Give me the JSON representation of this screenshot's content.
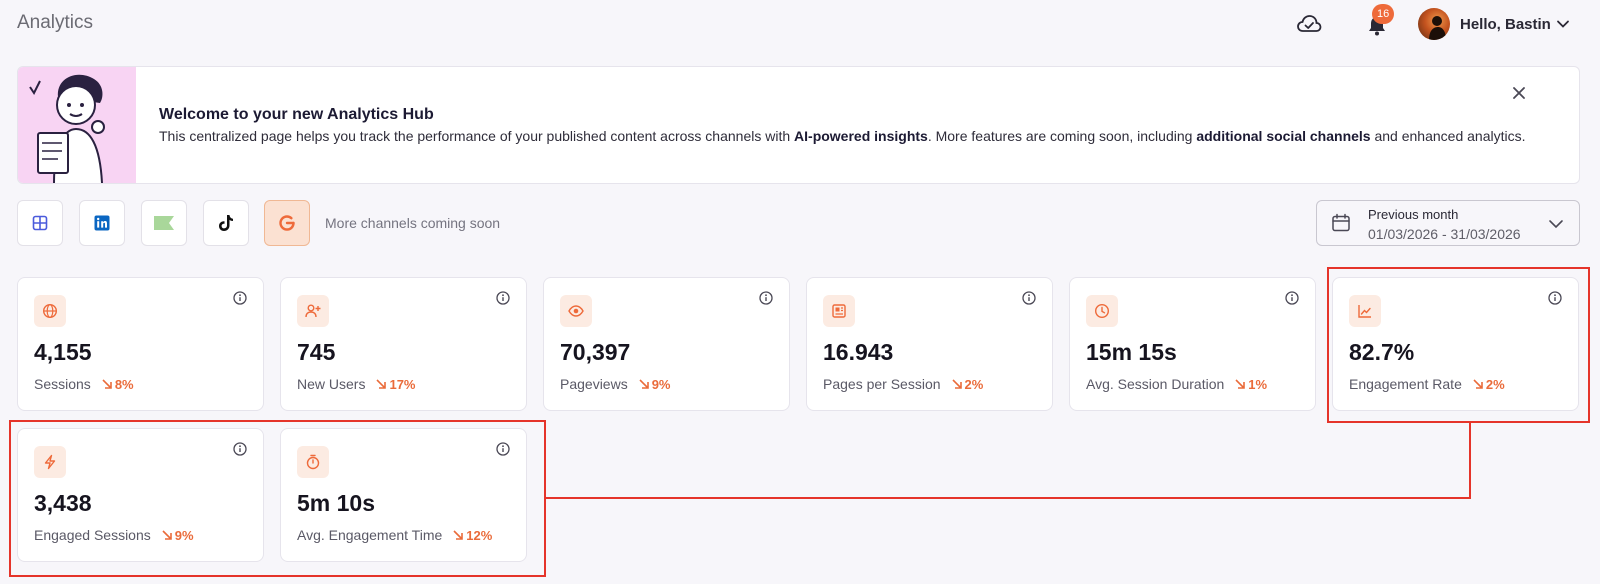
{
  "header": {
    "title": "Analytics",
    "notification_count": "16",
    "greeting": "Hello, Bastin"
  },
  "banner": {
    "title": "Welcome to your new Analytics Hub",
    "text_part1": "This centralized page helps you track the performance of your published content across channels with ",
    "text_bold1": "AI-powered insights",
    "text_part2": ". More features are coming soon, including ",
    "text_bold2": "additional social channels",
    "text_part3": " and enhanced analytics."
  },
  "channels": {
    "items": [
      {
        "name": "all-channels-icon",
        "color": "#4b5bdc"
      },
      {
        "name": "linkedin-icon",
        "color": "#0a66c2"
      },
      {
        "name": "flag-icon",
        "color": "#a9d79a"
      },
      {
        "name": "tiktok-icon",
        "color": "#111111"
      },
      {
        "name": "google-icon",
        "color": "#ee6a3a",
        "active": true
      }
    ],
    "note": "More channels coming soon"
  },
  "date_filter": {
    "label": "Previous month",
    "range": "01/03/2026 - 31/03/2026"
  },
  "metrics": [
    {
      "icon": "globe-icon",
      "value": "4,155",
      "label": "Sessions",
      "delta": "8%"
    },
    {
      "icon": "user-plus-icon",
      "value": "745",
      "label": "New Users",
      "delta": "17%"
    },
    {
      "icon": "eye-icon",
      "value": "70,397",
      "label": "Pageviews",
      "delta": "9%"
    },
    {
      "icon": "pages-icon",
      "value": "16.943",
      "label": "Pages per Session",
      "delta": "2%"
    },
    {
      "icon": "clock-icon",
      "value": "15m 15s",
      "label": "Avg. Session Duration",
      "delta": "1%"
    },
    {
      "icon": "trend-icon",
      "value": "82.7%",
      "label": "Engagement Rate",
      "delta": "2%"
    },
    {
      "icon": "bolt-icon",
      "value": "3,438",
      "label": "Engaged Sessions",
      "delta": "9%"
    },
    {
      "icon": "timer-icon",
      "value": "5m 10s",
      "label": "Avg. Engagement Time",
      "delta": "12%"
    }
  ],
  "colors": {
    "accent": "#ee6a3a",
    "annotation": "#e5342a"
  }
}
